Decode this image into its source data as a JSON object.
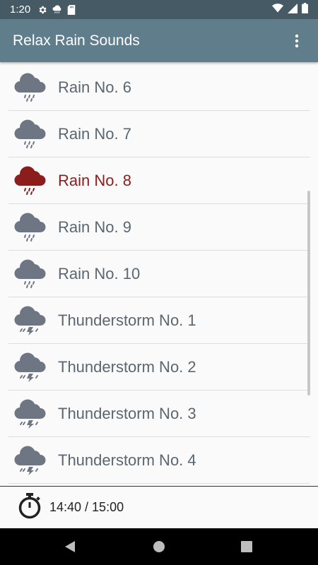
{
  "status_bar": {
    "time": "1:20",
    "icons": [
      "settings-icon",
      "weather-icon",
      "sd-card-icon",
      "wifi-icon",
      "signal-icon",
      "battery-icon"
    ]
  },
  "app_bar": {
    "title": "Relax Rain Sounds",
    "menu_icon": "more-vert-icon"
  },
  "colors": {
    "status_bar": "#455a64",
    "app_bar": "#607d8b",
    "item_text": "#5a6670",
    "selected": "#8b1d1d",
    "cloud": "#6f7683"
  },
  "sounds": {
    "items": [
      {
        "label": "Rain No. 6",
        "icon": "rain-cloud-icon",
        "selected": false
      },
      {
        "label": "Rain No. 7",
        "icon": "rain-cloud-icon",
        "selected": false
      },
      {
        "label": "Rain No. 8",
        "icon": "rain-cloud-icon",
        "selected": true
      },
      {
        "label": "Rain No. 9",
        "icon": "rain-cloud-icon",
        "selected": false
      },
      {
        "label": "Rain No. 10",
        "icon": "rain-cloud-icon",
        "selected": false
      },
      {
        "label": "Thunderstorm No. 1",
        "icon": "thunder-cloud-icon",
        "selected": false
      },
      {
        "label": "Thunderstorm No. 2",
        "icon": "thunder-cloud-icon",
        "selected": false
      },
      {
        "label": "Thunderstorm No. 3",
        "icon": "thunder-cloud-icon",
        "selected": false
      },
      {
        "label": "Thunderstorm No. 4",
        "icon": "thunder-cloud-icon",
        "selected": false
      }
    ]
  },
  "footer": {
    "timer_icon": "stopwatch-icon",
    "timer_text": "14:40 / 15:00"
  },
  "nav_bar": {
    "icons": [
      "back-icon",
      "home-icon",
      "recents-icon"
    ]
  }
}
